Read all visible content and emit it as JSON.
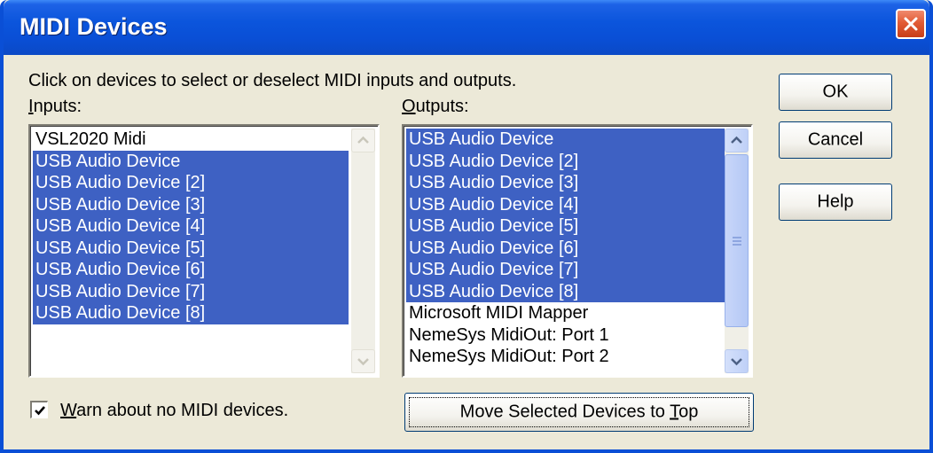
{
  "window": {
    "title": "MIDI Devices"
  },
  "instruction": "Click on devices to select or deselect MIDI inputs and outputs.",
  "inputs": {
    "label": "Inputs:",
    "items": [
      {
        "label": "VSL2020 Midi",
        "selected": false
      },
      {
        "label": "USB Audio Device",
        "selected": true
      },
      {
        "label": "USB Audio Device [2]",
        "selected": true
      },
      {
        "label": "USB Audio Device [3]",
        "selected": true
      },
      {
        "label": "USB Audio Device [4]",
        "selected": true
      },
      {
        "label": "USB Audio Device [5]",
        "selected": true
      },
      {
        "label": "USB Audio Device [6]",
        "selected": true
      },
      {
        "label": "USB Audio Device [7]",
        "selected": true
      },
      {
        "label": "USB Audio Device [8]",
        "selected": true
      }
    ]
  },
  "outputs": {
    "label": "Outputs:",
    "items": [
      {
        "label": "USB Audio Device",
        "selected": true
      },
      {
        "label": "USB Audio Device [2]",
        "selected": true
      },
      {
        "label": "USB Audio Device [3]",
        "selected": true
      },
      {
        "label": "USB Audio Device [4]",
        "selected": true
      },
      {
        "label": "USB Audio Device [5]",
        "selected": true
      },
      {
        "label": "USB Audio Device [6]",
        "selected": true
      },
      {
        "label": "USB Audio Device [7]",
        "selected": true
      },
      {
        "label": "USB Audio Device [8]",
        "selected": true
      },
      {
        "label": "Microsoft MIDI Mapper",
        "selected": false
      },
      {
        "label": "NemeSys MidiOut: Port 1",
        "selected": false
      },
      {
        "label": "NemeSys MidiOut: Port 2",
        "selected": false
      }
    ]
  },
  "buttons": {
    "ok": "OK",
    "cancel": "Cancel",
    "help": "Help",
    "move_top": "Move Selected Devices to Top"
  },
  "warn": {
    "label": "Warn about no MIDI devices.",
    "checked": true
  },
  "colors": {
    "selection": "#3e61c3",
    "dialog": "#ece9d8",
    "titlebar": "#0a4fd6"
  },
  "icons": {
    "close": "close-icon",
    "check": "check-icon"
  }
}
